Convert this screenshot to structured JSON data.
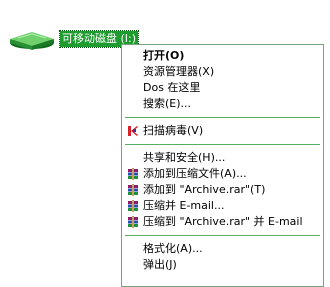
{
  "drive": {
    "label": "可移动磁盘 (I:)",
    "icon": "removable-drive-icon"
  },
  "context_menu": {
    "groups": [
      {
        "items": [
          {
            "label": "打开(O)",
            "bold": true
          },
          {
            "label": "资源管理器(X)"
          },
          {
            "label": "Dos 在这里"
          },
          {
            "label": "搜索(E)..."
          }
        ]
      },
      {
        "items": [
          {
            "label": "扫描病毒(V)",
            "icon": "antivirus-scan-icon"
          }
        ]
      },
      {
        "items": [
          {
            "label": "共享和安全(H)..."
          },
          {
            "label": "添加到压缩文件(A)...",
            "icon": "winrar-archive-icon"
          },
          {
            "label": "添加到 \"Archive.rar\"(T)",
            "icon": "winrar-archive-icon"
          },
          {
            "label": "压缩并 E-mail...",
            "icon": "winrar-archive-icon"
          },
          {
            "label": "压缩到 \"Archive.rar\" 并 E-mail",
            "icon": "winrar-archive-icon"
          }
        ]
      },
      {
        "items": [
          {
            "label": "格式化(A)..."
          },
          {
            "label": "弹出(J)"
          }
        ]
      }
    ]
  },
  "colors": {
    "selection_green": "#1e9b2e",
    "separator_green": "#5aab64",
    "menu_border": "#79a37e"
  }
}
